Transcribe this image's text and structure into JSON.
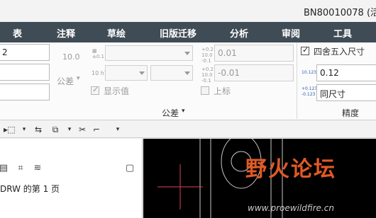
{
  "window": {
    "title": "BN80010078 (活"
  },
  "menu": [
    "表",
    "注释",
    "草绘",
    "旧版迁移",
    "分析",
    "审阅",
    "工具"
  ],
  "ribbon": {
    "left_value": "2",
    "value_group": {
      "tolerance_icon_label": "10.0",
      "tolerance_label": "公差",
      "select1_icon_label": "±0.1",
      "select2_icon_label": "10 h7",
      "show_value_label": "显示值"
    },
    "tolerance_group": {
      "upper_icon": {
        "top": "+0.2",
        "mid": "10.0",
        "bot": "-0.1"
      },
      "upper_value": "0.01",
      "lower_icon": {
        "top": "+0.2",
        "mid": "10.0",
        "bot": "-0.1"
      },
      "lower_value": "-0.01",
      "superscript_label": "上标",
      "group_label": "公差"
    },
    "precision_group": {
      "round_checkbox_label": "四舍五入尺寸",
      "round_checked": true,
      "decimal_icon_label": "10.123",
      "decimal_value": "0.12",
      "tol_icon": {
        "top": "+0.123",
        "bot": "-0.123"
      },
      "same_size_value": "同尺寸",
      "group_label": "精度"
    }
  },
  "left_panel": {
    "page_text": "DRW 的第 1 页"
  },
  "watermark": {
    "text": "野火论坛",
    "url": "www.proewildfire.cn"
  },
  "colors": {
    "menu_bg": "#3f4b55",
    "canvas_bg": "#000000",
    "accent_red": "#e0405a",
    "watermark_orange": "#e05a25"
  }
}
